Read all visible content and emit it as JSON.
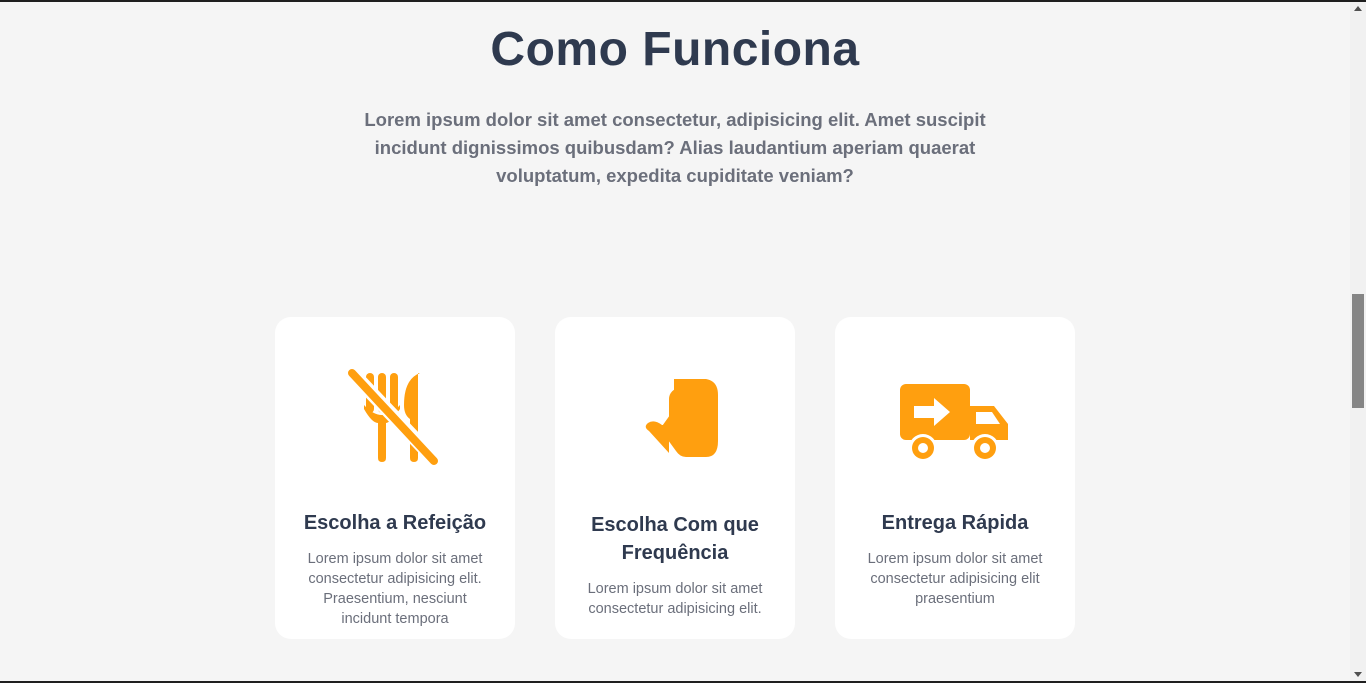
{
  "section": {
    "title": "Como Funciona",
    "intro_line1": "Lorem ipsum dolor sit amet consectetur, adipisicing elit. Amet suscipit",
    "intro_line2": "incidunt dignissimos quibusdam? Alias laudantium aperiam quaerat",
    "intro_line3": "voluptatum, expedita cupiditate veniam?"
  },
  "cards": [
    {
      "icon": "utensils-slash-icon",
      "title": "Escolha a Refeição",
      "desc_line1": "Lorem ipsum dolor sit amet",
      "desc_line2": "consectetur adipisicing elit.",
      "desc_line3": "Praesentium, nesciunt",
      "desc_line4": "incidunt tempora"
    },
    {
      "icon": "pointing-hand-icon",
      "title_line1": "Escolha Com que",
      "title_line2": "Frequência",
      "desc_line1": "Lorem ipsum dolor sit amet",
      "desc_line2": "consectetur adipisicing elit."
    },
    {
      "icon": "delivery-truck-icon",
      "title": "Entrega Rápida",
      "desc_line1": "Lorem ipsum dolor sit amet",
      "desc_line2": "consectetur adipisicing elit",
      "desc_line3": "praesentium"
    }
  ],
  "colors": {
    "accent": "#ff9f0f",
    "heading": "#2f3a4f",
    "text": "#6b6f7b",
    "background": "#f5f5f5",
    "card": "#ffffff"
  }
}
